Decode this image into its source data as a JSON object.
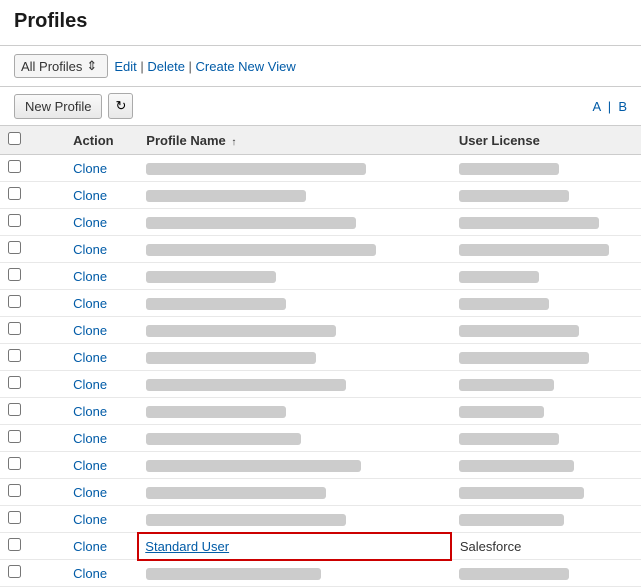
{
  "page": {
    "title": "Profiles",
    "view_selector": {
      "label": "All Profiles",
      "icon": "↕"
    },
    "view_actions": [
      {
        "label": "Edit",
        "href": "#"
      },
      {
        "label": "Delete",
        "href": "#"
      },
      {
        "label": "Create New View",
        "href": "#"
      }
    ],
    "toolbar": {
      "new_profile_label": "New Profile",
      "refresh_icon": "↻",
      "pagination": "A | B"
    },
    "table": {
      "columns": [
        {
          "label": "",
          "key": "checkbox"
        },
        {
          "label": "Action",
          "key": "action"
        },
        {
          "label": "Profile Name ↑",
          "key": "profile_name",
          "sortable": true
        },
        {
          "label": "User License",
          "key": "user_license"
        }
      ],
      "rows": [
        {
          "id": 1,
          "action": "Clone",
          "profile_name_blurred": true,
          "profile_name_width": 220,
          "user_license_blurred": true,
          "user_license_width": 100,
          "highlighted": false
        },
        {
          "id": 2,
          "action": "Clone",
          "profile_name_blurred": true,
          "profile_name_width": 160,
          "user_license_blurred": true,
          "user_license_width": 110,
          "highlighted": false
        },
        {
          "id": 3,
          "action": "Clone",
          "profile_name_blurred": true,
          "profile_name_width": 210,
          "user_license_blurred": true,
          "user_license_width": 140,
          "highlighted": false
        },
        {
          "id": 4,
          "action": "Clone",
          "profile_name_blurred": true,
          "profile_name_width": 230,
          "user_license_blurred": true,
          "user_license_width": 150,
          "highlighted": false
        },
        {
          "id": 5,
          "action": "Clone",
          "profile_name_blurred": true,
          "profile_name_width": 130,
          "user_license_blurred": true,
          "user_license_width": 80,
          "highlighted": false
        },
        {
          "id": 6,
          "action": "Clone",
          "profile_name_blurred": true,
          "profile_name_width": 140,
          "user_license_blurred": true,
          "user_license_width": 90,
          "highlighted": false
        },
        {
          "id": 7,
          "action": "Clone",
          "profile_name_blurred": true,
          "profile_name_width": 190,
          "user_license_blurred": true,
          "user_license_width": 120,
          "highlighted": false
        },
        {
          "id": 8,
          "action": "Clone",
          "profile_name_blurred": true,
          "profile_name_width": 170,
          "user_license_blurred": true,
          "user_license_width": 130,
          "highlighted": false
        },
        {
          "id": 9,
          "action": "Clone",
          "profile_name_blurred": true,
          "profile_name_width": 200,
          "user_license_blurred": true,
          "user_license_width": 95,
          "highlighted": false
        },
        {
          "id": 10,
          "action": "Clone",
          "profile_name_blurred": true,
          "profile_name_width": 140,
          "user_license_blurred": true,
          "user_license_width": 85,
          "highlighted": false
        },
        {
          "id": 11,
          "action": "Clone",
          "profile_name_blurred": true,
          "profile_name_width": 155,
          "user_license_blurred": true,
          "user_license_width": 100,
          "highlighted": false
        },
        {
          "id": 12,
          "action": "Clone",
          "profile_name_blurred": true,
          "profile_name_width": 215,
          "user_license_blurred": true,
          "user_license_width": 115,
          "highlighted": false
        },
        {
          "id": 13,
          "action": "Clone",
          "profile_name_blurred": true,
          "profile_name_width": 180,
          "user_license_blurred": true,
          "user_license_width": 125,
          "highlighted": false
        },
        {
          "id": 14,
          "action": "Clone",
          "profile_name_blurred": true,
          "profile_name_width": 200,
          "user_license_blurred": true,
          "user_license_width": 105,
          "highlighted": false
        },
        {
          "id": 15,
          "action": "Clone",
          "profile_name": "Standard User",
          "profile_name_blurred": false,
          "user_license": "Salesforce",
          "user_license_blurred": false,
          "highlighted": true
        },
        {
          "id": 16,
          "action": "Clone",
          "profile_name_blurred": true,
          "profile_name_width": 175,
          "user_license_blurred": true,
          "user_license_width": 110,
          "highlighted": false
        }
      ]
    }
  }
}
